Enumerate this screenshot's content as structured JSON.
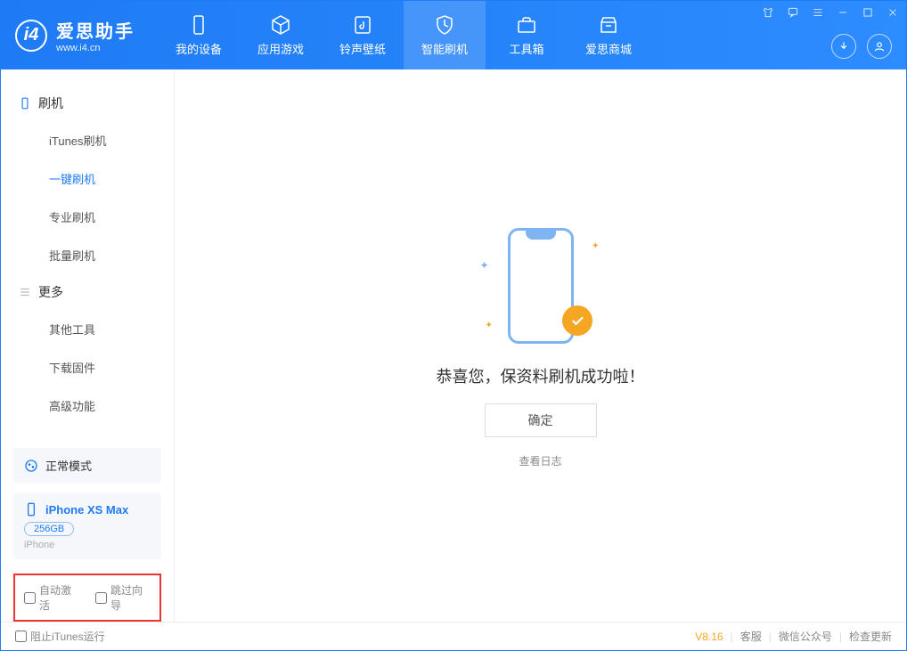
{
  "app": {
    "title": "爱思助手",
    "subtitle": "www.i4.cn"
  },
  "nav": {
    "tabs": [
      {
        "label": "我的设备"
      },
      {
        "label": "应用游戏"
      },
      {
        "label": "铃声壁纸"
      },
      {
        "label": "智能刷机"
      },
      {
        "label": "工具箱"
      },
      {
        "label": "爱思商城"
      }
    ]
  },
  "sidebar": {
    "group1": {
      "title": "刷机",
      "items": [
        "iTunes刷机",
        "一键刷机",
        "专业刷机",
        "批量刷机"
      ]
    },
    "group2": {
      "title": "更多",
      "items": [
        "其他工具",
        "下载固件",
        "高级功能"
      ]
    },
    "mode": "正常模式",
    "device": {
      "name": "iPhone XS Max",
      "capacity": "256GB",
      "kind": "iPhone"
    },
    "options": {
      "auto_activate": "自动激活",
      "skip_guide": "跳过向导"
    }
  },
  "main": {
    "success": "恭喜您，保资料刷机成功啦！",
    "ok": "确定",
    "view_log": "查看日志"
  },
  "footer": {
    "block_itunes": "阻止iTunes运行",
    "version": "V8.16",
    "support": "客服",
    "wechat": "微信公众号",
    "check_update": "检查更新"
  }
}
